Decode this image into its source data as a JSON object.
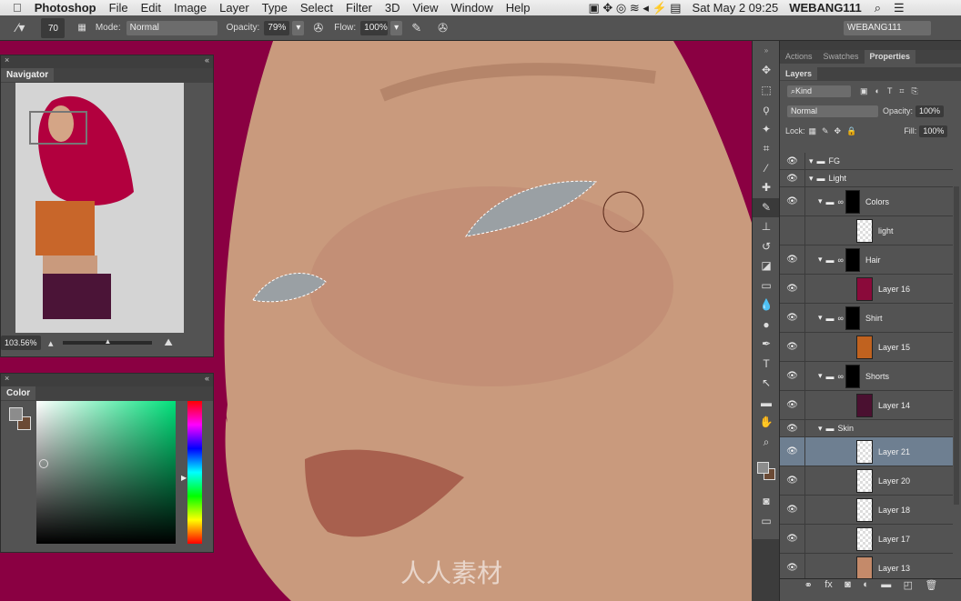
{
  "menubar": {
    "app": "Photoshop",
    "items": [
      "File",
      "Edit",
      "Image",
      "Layer",
      "Type",
      "Select",
      "Filter",
      "3D",
      "View",
      "Window",
      "Help"
    ],
    "clock": "Sat May 2  09:25",
    "user": "WEBANG111"
  },
  "options": {
    "brush_size": "70",
    "mode_label": "Mode:",
    "mode": "Normal",
    "opacity_label": "Opacity:",
    "opacity": "79%",
    "flow_label": "Flow:",
    "flow": "100%",
    "workspace": "WEBANG111"
  },
  "navigator": {
    "title": "Navigator",
    "zoom": "103.56%"
  },
  "color_panel": {
    "title": "Color",
    "foreground": "#8c8c8c",
    "background": "#6b4a35"
  },
  "panels": {
    "tabs": [
      "Actions",
      "Swatches",
      "Properties"
    ],
    "layers_tab": "Layers",
    "filter": "Kind",
    "blend": "Normal",
    "opacity_label": "Opacity:",
    "opacity": "100%",
    "lock_label": "Lock:",
    "fill_label": "Fill:",
    "fill": "100%"
  },
  "layers": [
    {
      "name": "FG",
      "type": "group",
      "visible": true
    },
    {
      "name": "Light",
      "type": "group",
      "visible": true
    },
    {
      "name": "Colors",
      "type": "group-mask",
      "visible": true
    },
    {
      "name": "light",
      "type": "layer",
      "visible": false
    },
    {
      "name": "Hair",
      "type": "group-mask",
      "visible": true
    },
    {
      "name": "Layer 16",
      "type": "layer",
      "visible": true,
      "color": "#8a0a3a"
    },
    {
      "name": "Shirt",
      "type": "group-mask",
      "visible": true
    },
    {
      "name": "Layer 15",
      "type": "layer",
      "visible": true,
      "color": "#c0621f"
    },
    {
      "name": "Shorts",
      "type": "group-mask",
      "visible": true
    },
    {
      "name": "Layer 14",
      "type": "layer",
      "visible": true,
      "color": "#4a1030"
    },
    {
      "name": "Skin",
      "type": "group",
      "visible": true
    },
    {
      "name": "Layer 21",
      "type": "layer",
      "visible": true,
      "selected": true
    },
    {
      "name": "Layer 20",
      "type": "layer",
      "visible": true
    },
    {
      "name": "Layer 18",
      "type": "layer",
      "visible": true
    },
    {
      "name": "Layer 17",
      "type": "layer",
      "visible": true
    },
    {
      "name": "Layer 13",
      "type": "layer",
      "visible": true,
      "color": "#c48a6a"
    }
  ],
  "watermark": "人人素材"
}
